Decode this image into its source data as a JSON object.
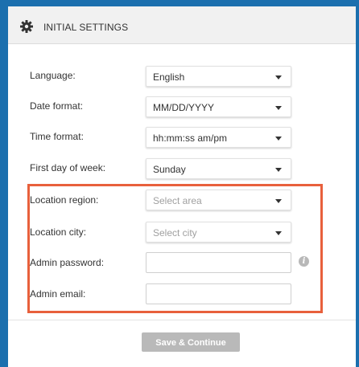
{
  "header": {
    "title": "INITIAL SETTINGS",
    "icon": "gear-icon"
  },
  "form": {
    "language": {
      "label": "Language:",
      "value": "English"
    },
    "date_format": {
      "label": "Date format:",
      "value": "MM/DD/YYYY"
    },
    "time_format": {
      "label": "Time format:",
      "value": "hh:mm:ss am/pm"
    },
    "first_day": {
      "label": "First day of week:",
      "value": "Sunday"
    },
    "location_region": {
      "label": "Location region:",
      "placeholder": "Select area"
    },
    "location_city": {
      "label": "Location city:",
      "placeholder": "Select city"
    },
    "admin_password": {
      "label": "Admin password:",
      "value": ""
    },
    "admin_email": {
      "label": "Admin email:",
      "value": ""
    }
  },
  "actions": {
    "save_label": "Save & Continue"
  },
  "colors": {
    "accent_blue": "#1b6fae",
    "highlight": "#e8603c",
    "button_disabled": "#b9b9b9"
  }
}
